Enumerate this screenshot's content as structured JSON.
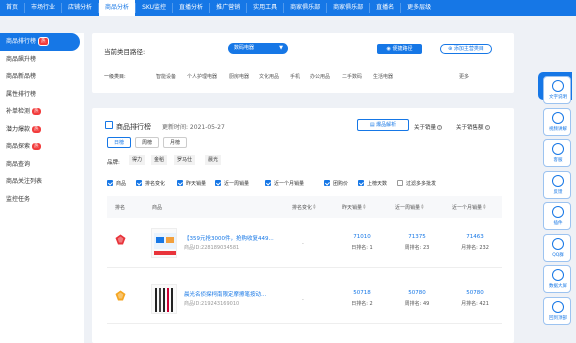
{
  "topnav": {
    "items": [
      "首页",
      "市场行业",
      "店铺分析",
      "商品分析",
      "SKU监控",
      "直播分析",
      "推广营销",
      "实用工具",
      "商家俱乐部",
      "商家俱乐部",
      "直播名",
      "更多层级"
    ],
    "active_index": 3,
    "accent": "#1677e6"
  },
  "sidebar": {
    "items": [
      {
        "label": "商品排行榜",
        "badge": "热"
      },
      {
        "label": "商品飙升榜",
        "badge": ""
      },
      {
        "label": "商品新品榜",
        "badge": ""
      },
      {
        "label": "属性排行榜",
        "badge": ""
      },
      {
        "label": "补单检测",
        "badge": "热"
      },
      {
        "label": "潜力爆款",
        "badge": "热"
      },
      {
        "label": "商品探索",
        "badge": "热"
      },
      {
        "label": "商品查询",
        "badge": ""
      },
      {
        "label": "商品关注列表",
        "badge": ""
      },
      {
        "label": "监控任务",
        "badge": ""
      }
    ],
    "active_index": 0
  },
  "path_panel": {
    "label": "当前类目路径:",
    "chip": "数码电器",
    "btn_path": "便捷路径",
    "btn_add": "添加主营类目",
    "cat_label": "一级类目:",
    "categories": [
      "智能设备",
      "个人护理电器",
      "厨房电器",
      "文化用品",
      "手机",
      "办公用品",
      "二手数码",
      "生活电器"
    ],
    "more": "更多"
  },
  "rank_panel": {
    "title": "商品排行榜",
    "update_time": "更新时间: 2021-05-27",
    "btn_analysis": "爆品解析",
    "about_sales": "关于销量",
    "about_amount": "关于销售额",
    "periods": [
      "日榜",
      "周榜",
      "月榜"
    ],
    "active_period": 0,
    "brand_label": "品牌:",
    "brands": [
      "得力",
      "金稻",
      "罗马仕",
      "晨光"
    ],
    "checks": [
      {
        "label": "商品",
        "on": true
      },
      {
        "label": "排名变化",
        "on": true
      },
      {
        "label": "昨天销量",
        "on": true
      },
      {
        "label": "近一周销量",
        "on": true
      },
      {
        "label": "近一个月销量",
        "on": true
      },
      {
        "label": "团购价",
        "on": true
      },
      {
        "label": "上榜天数",
        "on": true
      },
      {
        "label": "过滤多多批发",
        "on": false
      }
    ],
    "headers": {
      "rank": "排名",
      "product": "商品",
      "rank_change": "排名变化",
      "yesterday": "昨天销量",
      "week": "近一周销量",
      "month": "近一个月销量"
    },
    "rows": [
      {
        "name": "【359元抢3000件，抢购收复449...",
        "id": "商品ID:228189034581",
        "change": "-",
        "yesterday": "71010",
        "yesterday_sub": "日排名: 1",
        "week": "71375",
        "week_sub": "周排名: 23",
        "month": "71463",
        "month_sub": "月排名: 232",
        "badge_color": "#e8333a"
      },
      {
        "name": "晨光名侦探柯南限定摩擦笔按动...",
        "id": "商品ID:219243169010",
        "change": "-",
        "yesterday": "50718",
        "yesterday_sub": "日排名: 2",
        "week": "50780",
        "week_sub": "周排名: 49",
        "month": "50780",
        "month_sub": "月排名: 421",
        "badge_color": "#f5a623"
      }
    ]
  },
  "right_bar": {
    "collapse": "功能菜单",
    "tools": [
      {
        "label": "文字说明",
        "icon": "doc-icon"
      },
      {
        "label": "视频讲解",
        "icon": "video-icon"
      },
      {
        "label": "客服",
        "icon": "service-icon"
      },
      {
        "label": "反馈",
        "icon": "feedback-icon"
      },
      {
        "label": "插件",
        "icon": "plugin-icon"
      },
      {
        "label": "QQ群",
        "icon": "qq-icon"
      },
      {
        "label": "数据大屏",
        "icon": "screen-icon"
      },
      {
        "label": "回到顶部",
        "icon": "top-icon"
      }
    ]
  }
}
